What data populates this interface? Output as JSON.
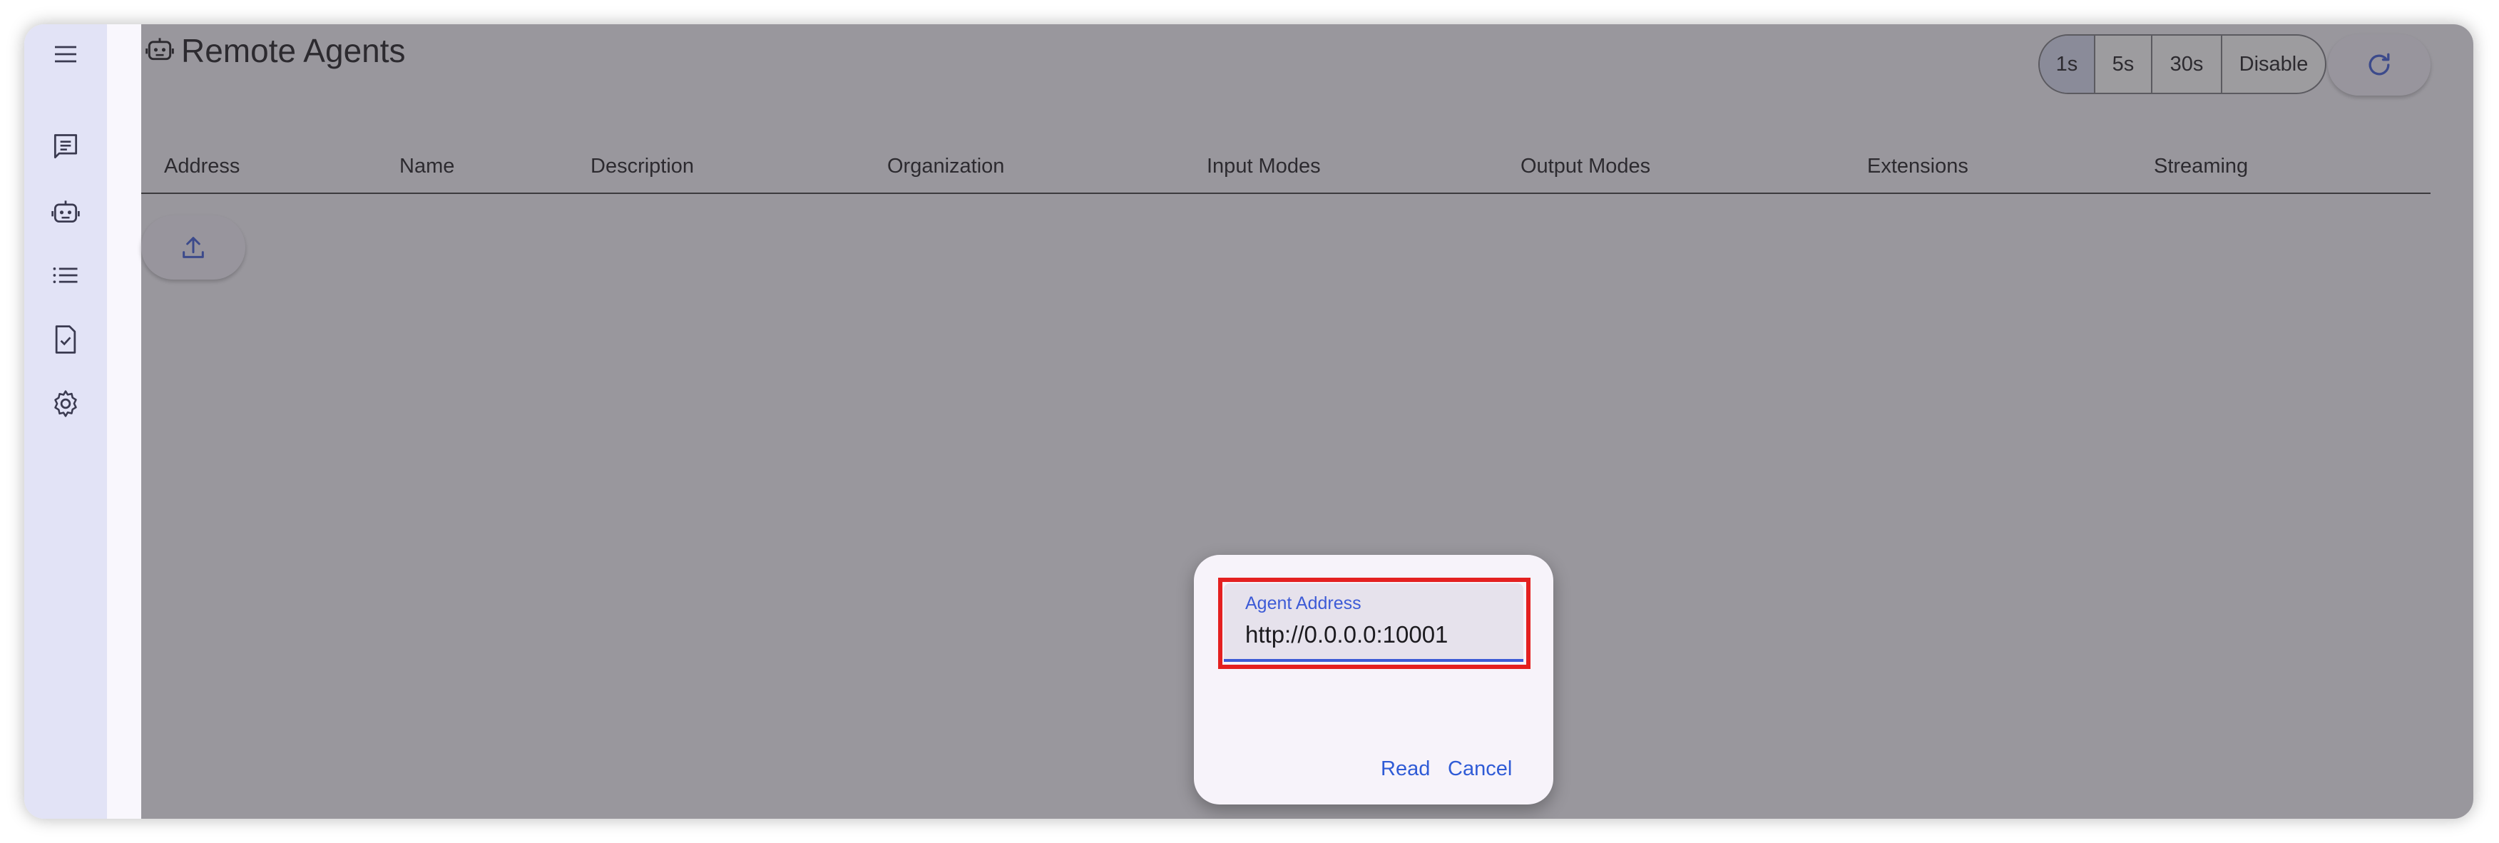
{
  "page": {
    "title": "Remote Agents"
  },
  "nav": {
    "items": [
      {
        "name": "menu",
        "icon": "menu-icon"
      },
      {
        "name": "conversations",
        "icon": "chat-icon"
      },
      {
        "name": "agents",
        "icon": "robot-icon"
      },
      {
        "name": "event-list",
        "icon": "list-icon"
      },
      {
        "name": "tasks",
        "icon": "task-icon"
      },
      {
        "name": "settings",
        "icon": "gear-icon"
      }
    ]
  },
  "refresh_intervals": {
    "options": [
      "1s",
      "5s",
      "30s",
      "Disable"
    ],
    "selected": "1s"
  },
  "table": {
    "columns": [
      "Address",
      "Name",
      "Description",
      "Organization",
      "Input Modes",
      "Output Modes",
      "Extensions",
      "Streaming"
    ],
    "rows": []
  },
  "dialog": {
    "field_label": "Agent Address",
    "field_value": "http://0.0.0.0:10001",
    "read_label": "Read",
    "cancel_label": "Cancel"
  },
  "colors": {
    "accent": "#3d5bd6",
    "highlight": "#e42020",
    "rail": "#e2e3f6"
  }
}
